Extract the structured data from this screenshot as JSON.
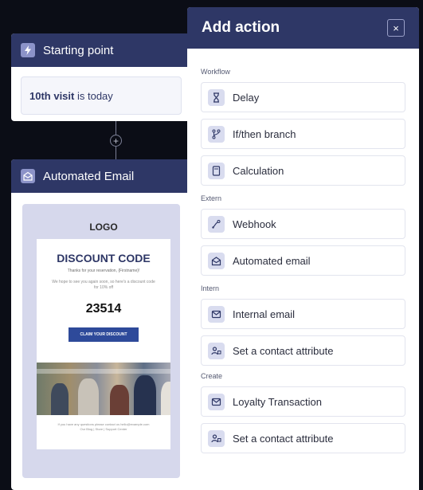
{
  "canvas": {
    "start_node": {
      "title": "Starting point",
      "trigger_bold": "10th visit",
      "trigger_rest": " is today"
    },
    "connector": {
      "symbol": "+"
    },
    "email_node": {
      "title": "Automated Email",
      "preview": {
        "logo": "LOGO",
        "heading": "DISCOUNT CODE",
        "thanks": "Thanks for your reservation, {Firstname}!",
        "hope": "We hope to see you again soon, so here's a discount code for 10% off",
        "code": "23514",
        "cta": "CLAIM YOUR DISCOUNT",
        "footer_line1": "If you have any questions please contact us hello@example.com",
        "footer_line2": "Our Blog | Store | Support Center"
      }
    }
  },
  "panel": {
    "title": "Add action",
    "close_symbol": "×",
    "sections": [
      {
        "label": "Workflow",
        "items": [
          {
            "label": "Delay",
            "icon": "hourglass-icon"
          },
          {
            "label": "If/then branch",
            "icon": "branch-icon"
          },
          {
            "label": "Calculation",
            "icon": "calculator-icon"
          }
        ]
      },
      {
        "label": "Extern",
        "items": [
          {
            "label": "Webhook",
            "icon": "webhook-icon"
          },
          {
            "label": "Automated email",
            "icon": "automated-email-icon"
          }
        ]
      },
      {
        "label": "Intern",
        "items": [
          {
            "label": "Internal email",
            "icon": "envelope-icon"
          },
          {
            "label": "Set a contact attribute",
            "icon": "contact-attribute-icon"
          }
        ]
      },
      {
        "label": "Create",
        "items": [
          {
            "label": "Loyalty Transaction",
            "icon": "envelope-icon"
          },
          {
            "label": "Set a contact attribute",
            "icon": "contact-attribute-icon"
          }
        ]
      }
    ]
  },
  "colors": {
    "accent": "#2e3766",
    "icon_bg": "#d9dcef",
    "canvas_bg": "#0b0d16"
  }
}
